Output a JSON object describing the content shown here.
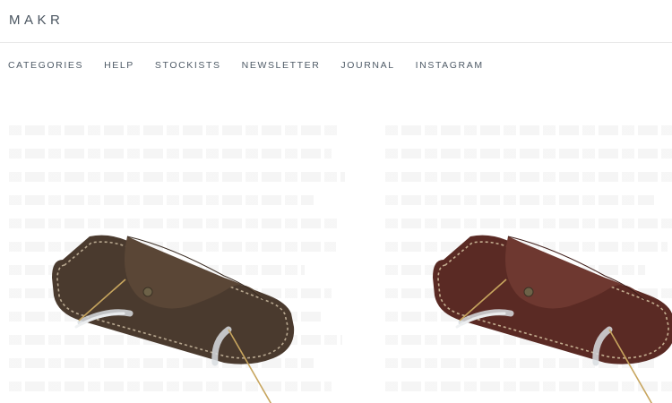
{
  "header": {
    "logo": "MAKR"
  },
  "nav": {
    "items": [
      {
        "label": "CATEGORIES"
      },
      {
        "label": "HELP"
      },
      {
        "label": "STOCKISTS"
      },
      {
        "label": "NEWSLETTER"
      },
      {
        "label": "JOURNAL"
      },
      {
        "label": "INSTAGRAM"
      }
    ]
  },
  "products": [
    {
      "color": "#4a3a2e",
      "stitch": "#b8a890",
      "image": "leather-glasses-case-dark-brown"
    },
    {
      "color": "#5a2a24",
      "stitch": "#c4ae90",
      "image": "leather-glasses-case-oxblood"
    }
  ],
  "colors": {
    "text": "#4e5a66",
    "divider": "#e8e8e8",
    "background": "#ffffff"
  }
}
